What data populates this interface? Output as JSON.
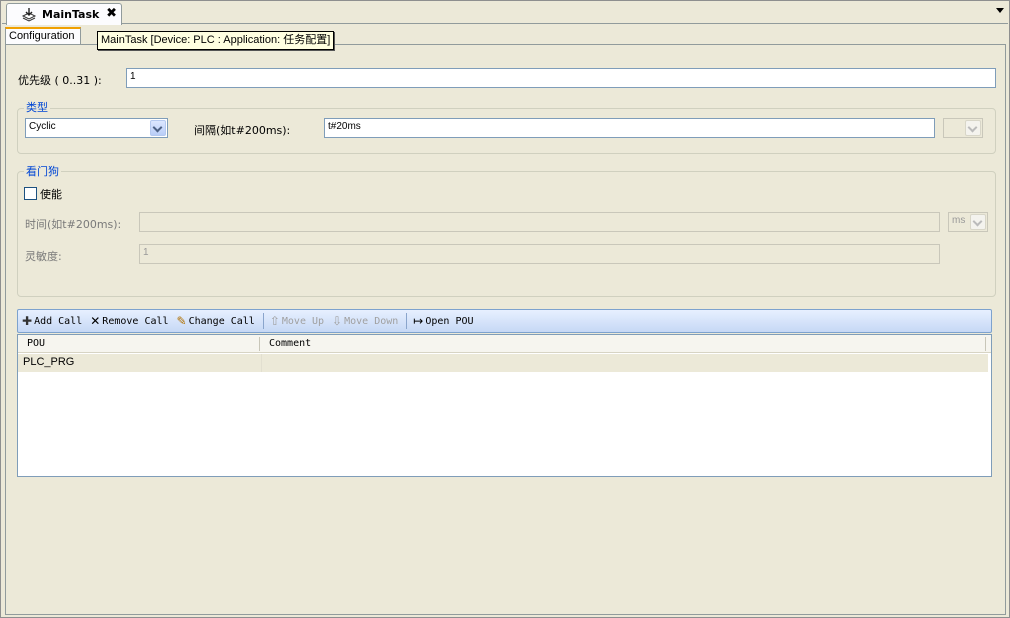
{
  "document_tab": {
    "title": "MainTask",
    "icon": "task-icon",
    "close": "✖"
  },
  "config_tab": {
    "label": "Configuration"
  },
  "tooltip": {
    "text": "MainTask [Device: PLC : Application: 任务配置]"
  },
  "priority": {
    "label": "优先级 ( 0..31 ):",
    "value": "1"
  },
  "type_group": {
    "title": "类型",
    "type_value": "Cyclic",
    "interval_label": "间隔(如t#200ms):",
    "interval_value": "t#20ms",
    "unit_value": ""
  },
  "watchdog_group": {
    "title": "看门狗",
    "enable_label": "使能",
    "enable_checked": false,
    "time_label": "时间(如t#200ms):",
    "time_value": "",
    "time_unit": "ms",
    "sensitivity_label": "灵敏度:",
    "sensitivity_value": "1"
  },
  "toolbar": {
    "add_call": "Add Call",
    "remove_call": "Remove Call",
    "change_call": "Change Call",
    "move_up": "Move Up",
    "move_down": "Move Down",
    "open_pou": "Open POU"
  },
  "grid": {
    "columns": [
      "POU",
      "Comment"
    ],
    "rows": [
      {
        "pou": "PLC_PRG",
        "comment": ""
      }
    ]
  }
}
